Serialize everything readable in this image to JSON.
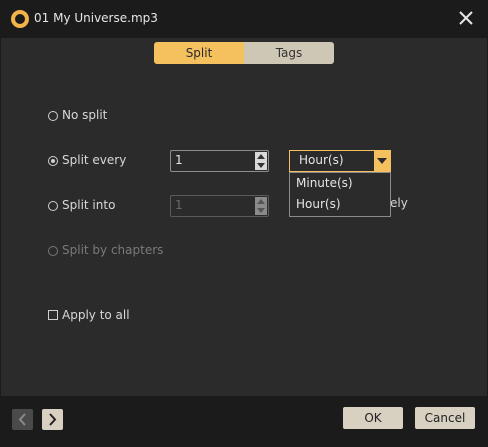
{
  "window": {
    "title": "01 My Universe.mp3"
  },
  "tabs": [
    {
      "label": "Split",
      "active": true
    },
    {
      "label": "Tags",
      "active": false
    }
  ],
  "options": {
    "no_split": "No split",
    "split_every": "Split every",
    "split_into": "Split into",
    "split_by_chapters": "Split by chapters"
  },
  "split_every": {
    "value": "1",
    "unit": "Hour(s)"
  },
  "split_into": {
    "value": "1",
    "suffix_partial": "ely"
  },
  "unit_dropdown": {
    "options": [
      "Minute(s)",
      "Hour(s)"
    ]
  },
  "apply_to_all": {
    "label": "Apply to all",
    "checked": false
  },
  "footer": {
    "ok": "OK",
    "cancel": "Cancel"
  },
  "colors": {
    "accent": "#f5c15f",
    "panel": "#2b2b2b",
    "frame": "#1b1b1b"
  }
}
